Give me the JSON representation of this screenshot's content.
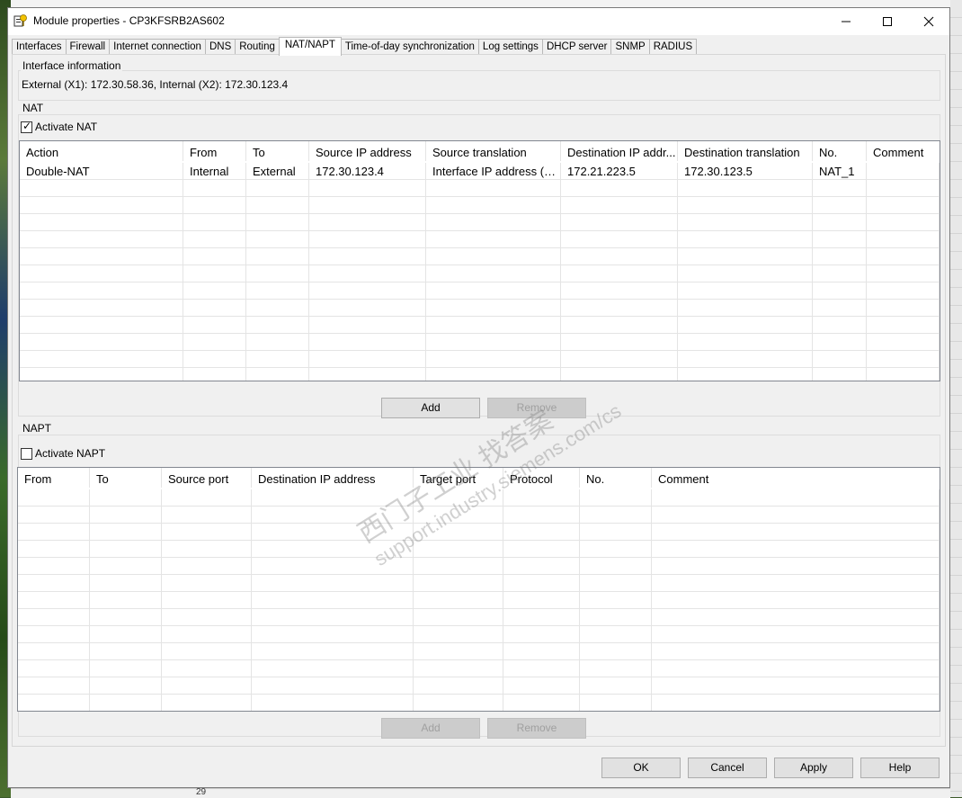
{
  "window": {
    "title": "Module properties - CP3KFSRB2AS602"
  },
  "tabs": [
    {
      "label": "Interfaces",
      "active": false
    },
    {
      "label": "Firewall",
      "active": false
    },
    {
      "label": "Internet connection",
      "active": false
    },
    {
      "label": "DNS",
      "active": false
    },
    {
      "label": "Routing",
      "active": false
    },
    {
      "label": "NAT/NAPT",
      "active": true
    },
    {
      "label": "Time-of-day synchronization",
      "active": false
    },
    {
      "label": "Log settings",
      "active": false
    },
    {
      "label": "DHCP server",
      "active": false
    },
    {
      "label": "SNMP",
      "active": false
    },
    {
      "label": "RADIUS",
      "active": false
    }
  ],
  "interface_info": {
    "group_label": "Interface information",
    "text": "External (X1): 172.30.58.36, Internal (X2): 172.30.123.4"
  },
  "nat": {
    "group_label": "NAT",
    "activate_label": "Activate NAT",
    "activate_checked": true,
    "columns": [
      "Action",
      "From",
      "To",
      "Source IP address",
      "Source translation",
      "Destination IP addr...",
      "Destination translation",
      "No.",
      "Comment"
    ],
    "rows": [
      [
        "Double-NAT",
        "Internal",
        "External",
        "172.30.123.4",
        "Interface IP address (Ex...",
        "172.21.223.5",
        "172.30.123.5",
        "NAT_1",
        ""
      ]
    ],
    "add_label": "Add",
    "remove_label": "Remove"
  },
  "napt": {
    "group_label": "NAPT",
    "activate_label": "Activate NAPT",
    "activate_checked": false,
    "columns": [
      "From",
      "To",
      "Source port",
      "Destination IP address",
      "Target port",
      "Protocol",
      "No.",
      "Comment"
    ],
    "rows": [],
    "add_label": "Add",
    "remove_label": "Remove"
  },
  "dialog_buttons": {
    "ok": "OK",
    "cancel": "Cancel",
    "apply": "Apply",
    "help": "Help"
  },
  "watermark": {
    "line1": "西门子工业  找答案",
    "line2": "support.industry.siemens.com/cs"
  },
  "background": {
    "row_number": "29"
  }
}
